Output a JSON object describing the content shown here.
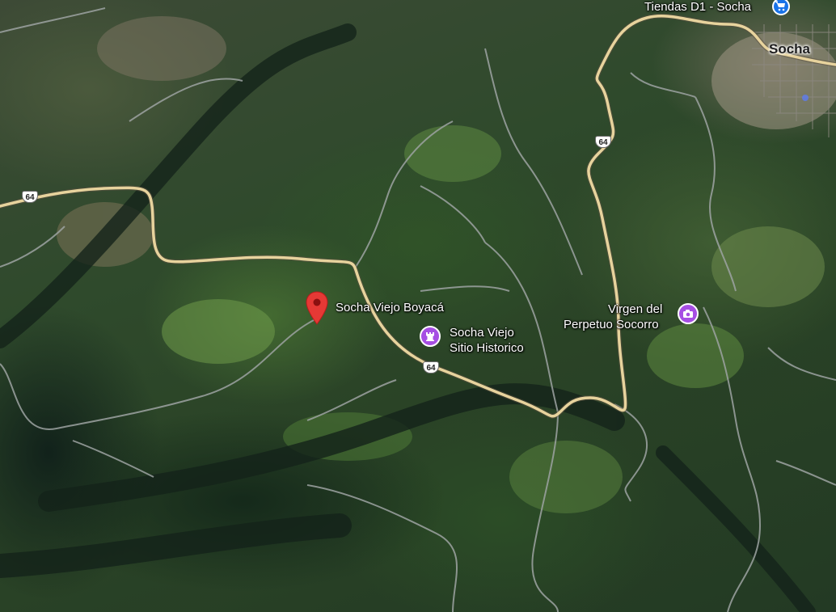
{
  "map": {
    "view": "satellite",
    "colors": {
      "road": "#e7d39d",
      "minor_road": "#9da3a2",
      "pin": "#e53935",
      "poi_purple": "#a64ee3",
      "shop_blue": "#1a73e8"
    }
  },
  "labels": {
    "town": "Socha",
    "tiendas": "Tiendas D1 - Socha",
    "selected_place": "Socha Viejo Boyacá",
    "historic_line1": "Socha Viejo",
    "historic_line2": "Sitio Historico",
    "virgen_line1": "Virgen del",
    "virgen_line2": "Perpetuo Socorro"
  },
  "routes": {
    "shield_1": "64",
    "shield_2": "64",
    "shield_3": "64"
  },
  "icons": {
    "selected_pin": "map-pin-icon",
    "historic": "landmark-icon",
    "virgen": "camera-icon",
    "tiendas": "shopping-cart-icon"
  }
}
